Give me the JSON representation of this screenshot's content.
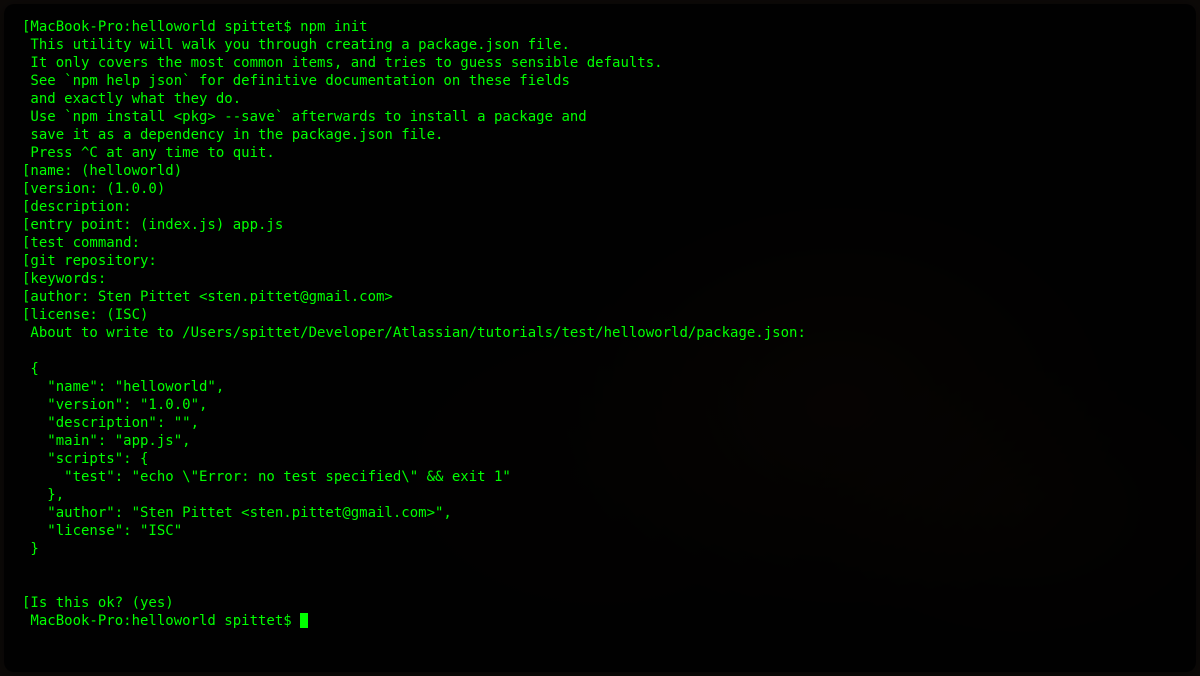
{
  "terminal": {
    "prompt1": "[MacBook-Pro:helloworld spittet$ npm init",
    "intro": [
      " This utility will walk you through creating a package.json file.",
      " It only covers the most common items, and tries to guess sensible defaults.",
      "",
      " See `npm help json` for definitive documentation on these fields",
      " and exactly what they do.",
      "",
      " Use `npm install <pkg> --save` afterwards to install a package and",
      " save it as a dependency in the package.json file.",
      "",
      " Press ^C at any time to quit."
    ],
    "prompts": [
      "[name: (helloworld)",
      "[version: (1.0.0)",
      "[description:",
      "[entry point: (index.js) app.js",
      "[test command:",
      "[git repository:",
      "[keywords:",
      "[author: Sten Pittet <sten.pittet@gmail.com>",
      "[license: (ISC)"
    ],
    "writeMsg": " About to write to /Users/spittet/Developer/Atlassian/tutorials/test/helloworld/package.json:",
    "json": [
      " {",
      "   \"name\": \"helloworld\",",
      "   \"version\": \"1.0.0\",",
      "   \"description\": \"\",",
      "   \"main\": \"app.js\",",
      "   \"scripts\": {",
      "     \"test\": \"echo \\\"Error: no test specified\\\" && exit 1\"",
      "   },",
      "   \"author\": \"Sten Pittet <sten.pittet@gmail.com>\",",
      "   \"license\": \"ISC\"",
      " }"
    ],
    "confirm": "[Is this ok? (yes)",
    "finalPrompt": " MacBook-Pro:helloworld spittet$ "
  }
}
